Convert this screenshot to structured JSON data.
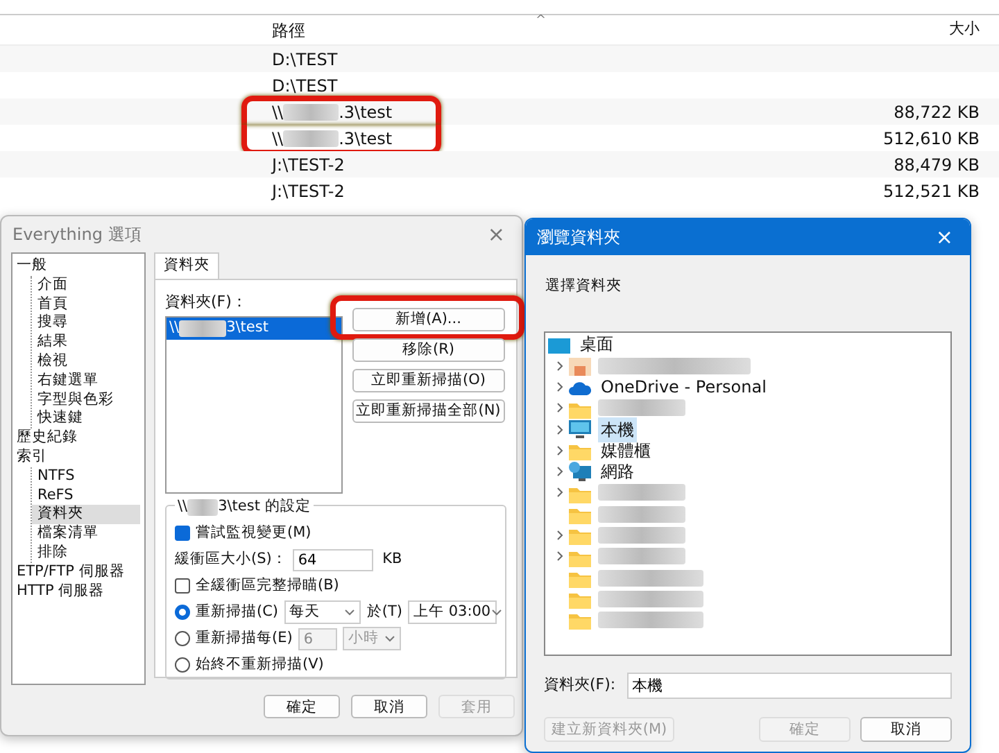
{
  "file_list": {
    "columns": [
      {
        "label": "路徑",
        "sort_indicator": "^"
      },
      {
        "label": "大小"
      }
    ],
    "rows": [
      {
        "path": {
          "before": "D:\\TEST"
        },
        "size": "",
        "highlighted": false
      },
      {
        "path": {
          "before": "D:\\TEST"
        },
        "size": "",
        "highlighted": false
      },
      {
        "path": {
          "before": "\\\\",
          "redacted": true,
          "after": ".3\\test"
        },
        "size": "88,722 KB",
        "highlighted": true
      },
      {
        "path": {
          "before": "\\\\",
          "redacted": true,
          "after": ".3\\test"
        },
        "size": "512,610 KB",
        "highlighted": true
      },
      {
        "path": {
          "before": "J:\\TEST-2"
        },
        "size": "88,479 KB",
        "highlighted": false
      },
      {
        "path": {
          "before": "J:\\TEST-2"
        },
        "size": "512,521 KB",
        "highlighted": false
      }
    ]
  },
  "options_dialog": {
    "title": "Everything 選項",
    "close": "×",
    "tree": [
      {
        "label": "一般",
        "selected": false,
        "children": [
          {
            "label": "介面",
            "selected": false
          },
          {
            "label": "首頁",
            "selected": false
          },
          {
            "label": "搜尋",
            "selected": false
          },
          {
            "label": "結果",
            "selected": false
          },
          {
            "label": "檢視",
            "selected": false
          },
          {
            "label": "右鍵選單",
            "selected": false
          },
          {
            "label": "字型與色彩",
            "selected": false
          },
          {
            "label": "快速鍵",
            "selected": false
          }
        ]
      },
      {
        "label": "歷史紀錄",
        "selected": false
      },
      {
        "label": "索引",
        "selected": false,
        "children": [
          {
            "label": "NTFS",
            "selected": false
          },
          {
            "label": "ReFS",
            "selected": false
          },
          {
            "label": "資料夾",
            "selected": true
          },
          {
            "label": "檔案清單",
            "selected": false
          },
          {
            "label": "排除",
            "selected": false
          }
        ]
      },
      {
        "label": "ETP/FTP 伺服器",
        "selected": false
      },
      {
        "label": "HTTP 伺服器",
        "selected": false
      }
    ],
    "tab": "資料夾",
    "folders_label": "資料夾(F)：",
    "folders": [
      {
        "before": "\\\\",
        "redacted": true,
        "after": "3\\test",
        "selected": true
      }
    ],
    "side_buttons": [
      {
        "label": "新增(A)...",
        "highlighted": true
      },
      {
        "label": "移除(R)",
        "highlighted": false
      },
      {
        "label": "立即重新掃描(O)",
        "highlighted": false
      },
      {
        "label": "立即重新掃描全部(N)",
        "highlighted": false
      }
    ],
    "settings": {
      "legend_before": "\\\\",
      "legend_redacted": true,
      "legend_after": "3\\test 的設定",
      "monitor": {
        "label": "嘗試監視變更(M)",
        "checked": true
      },
      "buffer": {
        "label": "緩衝區大小(S)：",
        "value": "64",
        "unit": "KB"
      },
      "full_scan": {
        "label": "全緩衝區完整掃瞄(B)",
        "checked": false
      },
      "rescan_modes": [
        {
          "kind": "daily",
          "label": "重新掃描(C)",
          "selected": true,
          "period": "每天",
          "at_label": "於(T)",
          "time": "上午 03:00"
        },
        {
          "kind": "interval",
          "label": "重新掃描每(E)",
          "selected": false,
          "value": "6",
          "unit": "小時"
        },
        {
          "kind": "never",
          "label": "始終不重新掃描(V)",
          "selected": false
        }
      ]
    },
    "buttons": [
      {
        "label": "確定",
        "disabled": false
      },
      {
        "label": "取消",
        "disabled": false
      },
      {
        "label": "套用",
        "disabled": true
      }
    ]
  },
  "browse_dialog": {
    "title": "瀏覽資料夾",
    "close": "×",
    "prompt": "選擇資料夾",
    "tree": [
      {
        "label": "桌面",
        "kind": "desktop",
        "expandable": false,
        "selected": false,
        "children": [
          {
            "kind": "user",
            "redacted": true,
            "expandable": true,
            "selected": false
          },
          {
            "label": "OneDrive - Personal",
            "kind": "cloud",
            "expandable": true,
            "selected": false
          },
          {
            "kind": "folder",
            "redacted": true,
            "expandable": true,
            "selected": false
          },
          {
            "label": "本機",
            "kind": "computer",
            "expandable": true,
            "selected": true
          },
          {
            "label": "媒體櫃",
            "kind": "folder",
            "expandable": true,
            "selected": false
          },
          {
            "label": "網路",
            "kind": "network",
            "expandable": true,
            "selected": false
          },
          {
            "kind": "folder",
            "redacted": true,
            "expandable": true,
            "selected": false
          },
          {
            "kind": "folder",
            "redacted": true,
            "expandable": false,
            "selected": false
          },
          {
            "kind": "folder",
            "redacted": true,
            "expandable": true,
            "selected": false
          },
          {
            "kind": "folder",
            "redacted": true,
            "expandable": true,
            "selected": false
          },
          {
            "kind": "folder",
            "redacted": true,
            "expandable": false,
            "selected": false
          },
          {
            "kind": "folder",
            "redacted": true,
            "expandable": false,
            "selected": false
          },
          {
            "kind": "folder",
            "redacted": true,
            "expandable": false,
            "selected": false
          }
        ]
      }
    ],
    "folder_label": "資料夾(F):",
    "folder_value": "本機",
    "buttons": [
      {
        "label": "建立新資料夾(M)",
        "disabled": true
      },
      {
        "label": "確定",
        "disabled": true
      },
      {
        "label": "取消",
        "disabled": false
      }
    ]
  }
}
